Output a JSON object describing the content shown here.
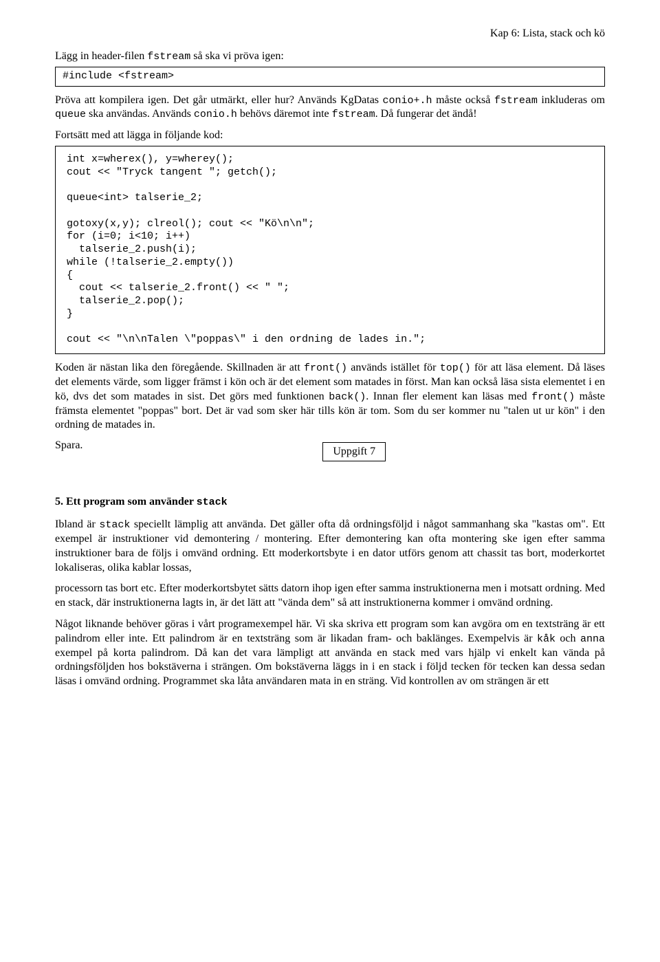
{
  "header": {
    "chapter": "Kap 6:  Lista, stack och kö"
  },
  "intro": {
    "line1_a": "Lägg in header-filen ",
    "line1_code": "fstream",
    "line1_b": " så ska vi pröva igen:"
  },
  "codebox1": "#include <fstream>",
  "para2": {
    "t1": "Pröva att kompilera igen. Det går utmärkt, eller hur? Används KgDatas ",
    "c1": "conio+.h",
    "t2": "  måste också ",
    "c2": "fstream",
    "t3": " inkluderas om ",
    "c3": "queue",
    "t4": " ska användas. Används ",
    "c4": "conio.h",
    "t5": " behövs däremot inte ",
    "c5": "fstream",
    "t6": ". Då fungerar det ändå!"
  },
  "para3": "Fortsätt med att lägga in följande kod:",
  "codebox2": "int x=wherex(), y=wherey();\ncout << \"Tryck tangent \"; getch();\n\nqueue<int> talserie_2;\n\ngotoxy(x,y); clreol(); cout << \"Kö\\n\\n\";\nfor (i=0; i<10; i++)\n  talserie_2.push(i);\nwhile (!talserie_2.empty())\n{\n  cout << talserie_2.front() << \" \";\n  talserie_2.pop();\n}\n\ncout << \"\\n\\nTalen \\\"poppas\\\" i den ordning de lades in.\";",
  "para4": {
    "t1": "Koden är nästan lika den föregående. Skillnaden är att ",
    "c1": "front()",
    "t2": " används istället för ",
    "c2": "top()",
    "t3": " för att läsa element. Då läses det elements värde, som ligger främst i kön och är det element som matades in först. Man kan också läsa sista elementet i en kö, dvs det som matades in sist. Det görs med funktionen ",
    "c3": "back()",
    "t4": ". Innan fler element kan läsas med ",
    "c4": "front()",
    "t5": " måste främsta elementet \"poppas\" bort. Det är vad som sker här tills kön är tom. Som du ser kommer nu \"talen ut ur kön\" i den ordning de matades in."
  },
  "spara": "Spara.",
  "task": "Uppgift 7",
  "section5": {
    "num": "5. Ett program som använder ",
    "code": "stack"
  },
  "para5": {
    "t1": "Ibland är ",
    "c1": "stack",
    "t2": " speciellt lämplig att använda. Det gäller ofta då ordningsföljd i något sammanhang ska \"kastas om\". Ett exempel är instruktioner vid demontering / montering. Efter demontering kan ofta montering ske igen efter samma instruktioner bara de följs i omvänd ordning. Ett moderkortsbyte i en dator utförs genom att chassit tas bort, moderkortet lokaliseras, olika kablar lossas,"
  },
  "para6": "processorn tas bort etc. Efter moderkortsbytet sätts datorn ihop igen efter samma instruktionerna men i motsatt ordning. Med en stack, där instruktionerna lagts in, är det lätt att \"vända dem\" så att instruktionerna kommer i omvänd ordning.",
  "para7": {
    "t1": "Något liknande behöver göras i vårt programexempel här. Vi ska skriva ett program som kan avgöra om en textsträng är ett palindrom eller inte. Ett palindrom är en textsträng som är likadan fram- och baklänges. Exempelvis är ",
    "c1": "kåk",
    "t2": " och ",
    "c2": "anna",
    "t3": " exempel på korta palindrom. Då kan det vara lämpligt att använda en stack med vars hjälp vi enkelt kan vända på ordningsföljden hos bokstäverna i strängen. Om bokstäverna läggs in i en stack i följd tecken för tecken kan dessa sedan läsas i omvänd ordning. Programmet ska låta användaren mata in en sträng. Vid kontrollen av om strängen är ett"
  }
}
